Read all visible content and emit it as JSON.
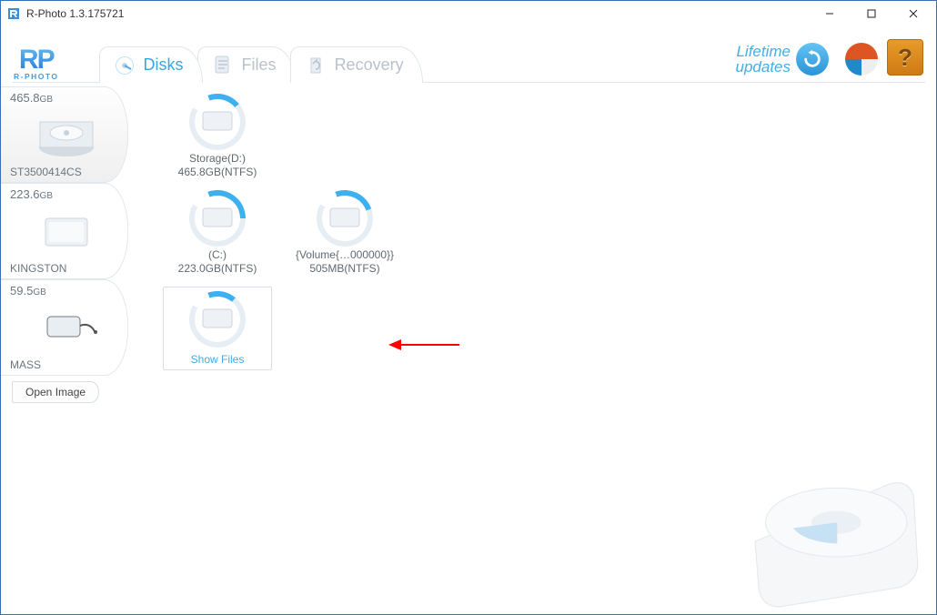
{
  "window": {
    "title": "R-Photo 1.3.175721"
  },
  "logo": {
    "top": "RP",
    "sub": "R-PHOTO"
  },
  "tabs": {
    "disks": "Disks",
    "files": "Files",
    "recovery": "Recovery",
    "active": "disks"
  },
  "updates": {
    "line1": "Lifetime",
    "line2": "updates"
  },
  "help": {
    "label": "?"
  },
  "disks": [
    {
      "size": "465.8",
      "unit": "GB",
      "name": "ST3500414CS",
      "kind": "hdd"
    },
    {
      "size": "223.6",
      "unit": "GB",
      "name": "KINGSTON",
      "kind": "ssd"
    },
    {
      "size": "59.5",
      "unit": "GB",
      "name": "MASS",
      "kind": "usb"
    }
  ],
  "volumes": [
    [
      {
        "label": "Storage(D:)",
        "detail": "465.8GB(NTFS)",
        "pct": 70
      }
    ],
    [
      {
        "label": "(C:)",
        "detail": "223.0GB(NTFS)",
        "pct": 110
      },
      {
        "label": "{Volume{…000000}}",
        "detail": "505MB(NTFS)",
        "pct": 90
      }
    ],
    [
      {
        "selected": true,
        "showFiles": "Show Files",
        "pct": 60
      }
    ]
  ],
  "openImage": "Open Image"
}
